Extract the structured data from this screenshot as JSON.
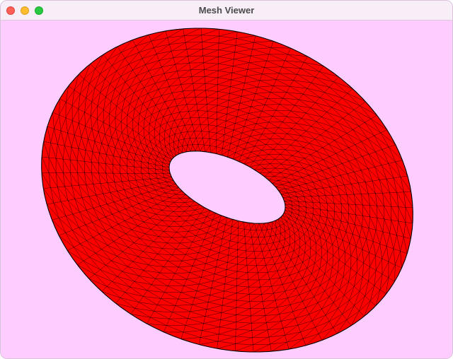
{
  "window": {
    "title": "Mesh Viewer"
  },
  "viewport": {
    "background_color": "#ffccff",
    "model": {
      "shape": "torus",
      "fill_color": "#ff0000",
      "wire_color": "#000000"
    }
  },
  "traffic_lights": {
    "close_color": "#ff5f57",
    "minimize_color": "#febc2e",
    "zoom_color": "#28c840"
  }
}
